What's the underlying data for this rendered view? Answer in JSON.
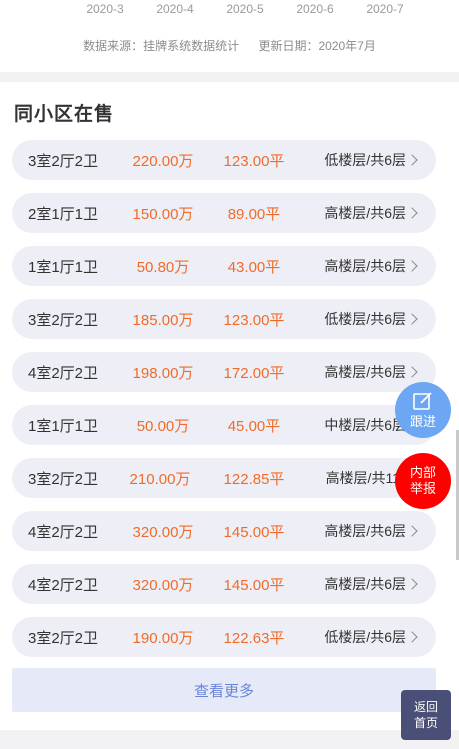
{
  "chart_tail": {
    "months": [
      "2020-3",
      "2020-4",
      "2020-5",
      "2020-6",
      "2020-7"
    ],
    "source_label": "数据来源：挂牌系统数据统计",
    "update_label": "更新日期：2020年7月"
  },
  "section": {
    "title": "同小区在售",
    "more_label": "查看更多"
  },
  "listings": [
    {
      "layout": "3室2厅2卫",
      "price": "220.00万",
      "area": "123.00平",
      "floor": "低楼层/共6层"
    },
    {
      "layout": "2室1厅1卫",
      "price": "150.00万",
      "area": "89.00平",
      "floor": "高楼层/共6层"
    },
    {
      "layout": "1室1厅1卫",
      "price": "50.80万",
      "area": "43.00平",
      "floor": "高楼层/共6层"
    },
    {
      "layout": "3室2厅2卫",
      "price": "185.00万",
      "area": "123.00平",
      "floor": "低楼层/共6层"
    },
    {
      "layout": "4室2厅2卫",
      "price": "198.00万",
      "area": "172.00平",
      "floor": "高楼层/共6层"
    },
    {
      "layout": "1室1厅1卫",
      "price": "50.00万",
      "area": "45.00平",
      "floor": "中楼层/共6层"
    },
    {
      "layout": "3室2厅2卫",
      "price": "210.00万",
      "area": "122.85平",
      "floor": "高楼层/共11层"
    },
    {
      "layout": "4室2厅2卫",
      "price": "320.00万",
      "area": "145.00平",
      "floor": "高楼层/共6层"
    },
    {
      "layout": "4室2厅2卫",
      "price": "320.00万",
      "area": "145.00平",
      "floor": "高楼层/共6层"
    },
    {
      "layout": "3室2厅2卫",
      "price": "190.00万",
      "area": "122.63平",
      "floor": "低楼层/共6层"
    }
  ],
  "floating": {
    "follow_label": "跟进",
    "report_line1": "内部",
    "report_line2": "举报",
    "back_line1": "返回",
    "back_line2": "首页"
  },
  "colors": {
    "accent_orange": "#f06b2a",
    "more_blue": "#6a84d8",
    "follow_blue": "#6da6f2",
    "report_red": "#ff0000",
    "back_navy": "#4a4f77"
  },
  "icons": {
    "follow": "edit-icon",
    "row_arrow": "chevron-right-icon"
  }
}
